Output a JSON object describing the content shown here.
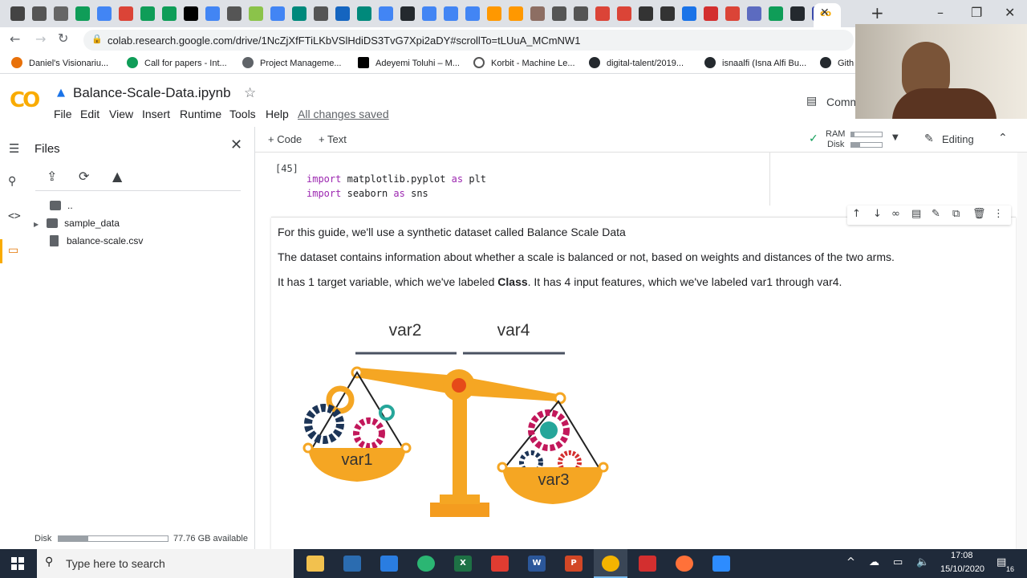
{
  "browser": {
    "url": "colab.research.google.com/drive/1NcZjXfFTiLKbVSlHdiDS3TvG7Xpi2aDY#scrollTo=tLUuA_MCmNW1",
    "bookmarks": [
      "Daniel's Visionariu...",
      "Call for papers - Int...",
      "Project Manageme...",
      "Adeyemi Toluhi – M...",
      "Korbit - Machine Le...",
      "digital-talent/2019...",
      "isnaalfi (Isna Alfi Bu...",
      "Gith"
    ],
    "new_tab": "+",
    "close_tab": "✕"
  },
  "colab": {
    "logo": "CO",
    "notebook_title": "Balance-Scale-Data.ipynb",
    "menu": [
      "File",
      "Edit",
      "View",
      "Insert",
      "Runtime",
      "Tools",
      "Help"
    ],
    "save_status": "All changes saved",
    "comment_label": "Comm",
    "add_code": "+ Code",
    "add_text": "+ Text",
    "ram_label": "RAM",
    "disk_label": "Disk",
    "editing_label": "Editing",
    "accent": "#f9ab00"
  },
  "sidebar": {
    "title": "Files",
    "files": [
      {
        "name": "..",
        "type": "folder-up"
      },
      {
        "name": "sample_data",
        "type": "folder"
      },
      {
        "name": "balance-scale.csv",
        "type": "file"
      }
    ],
    "disk_label": "Disk",
    "disk_available": "77.76 GB available",
    "disk_used_fraction": 0.27
  },
  "notebook": {
    "exec_count": "[45]",
    "code_lines": [
      {
        "kw": "import",
        "mod": "matplotlib.pyplot",
        "as": "as",
        "alias": "plt"
      },
      {
        "kw": "import",
        "mod": "seaborn",
        "as": "as",
        "alias": "sns"
      }
    ],
    "text1": "For this guide, we'll use a synthetic dataset called Balance Scale Data",
    "text2": "The dataset contains information about whether a scale is balanced or not, based on weights and distances of the two arms.",
    "text3_a": "It has 1 target variable, which we've labeled ",
    "text3_b": "Class",
    "text3_c": ". It has 4 input features, which we've labeled var1 through var4.",
    "image_labels": {
      "var2": "var2",
      "var4": "var4",
      "var1": "var1",
      "var3": "var3"
    }
  },
  "taskbar": {
    "search_placeholder": "Type here to search",
    "time": "17:08",
    "date": "15/10/2020",
    "notif_count": "16"
  }
}
